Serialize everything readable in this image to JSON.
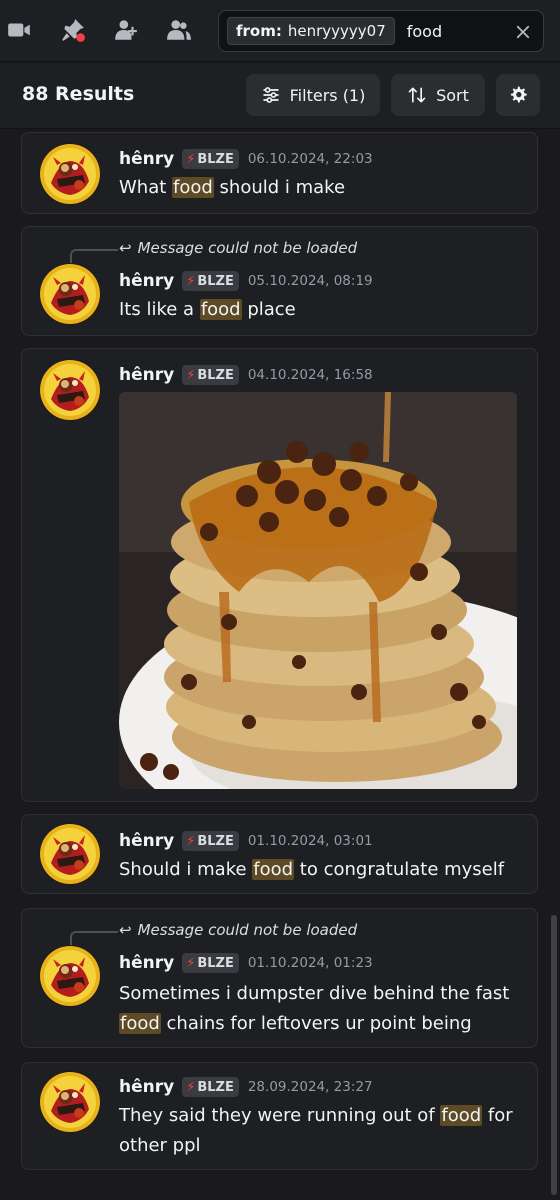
{
  "toolbar": {
    "icons": [
      "video-camera-icon",
      "pinned-messages-icon",
      "add-member-icon",
      "members-icon"
    ],
    "search": {
      "filter_key": "from:",
      "filter_value": "henryyyyy07",
      "query": "food"
    }
  },
  "results_header": {
    "count_label": "88 Results",
    "filters_label": "Filters (1)",
    "sort_label": "Sort"
  },
  "messages": [
    {
      "username": "hênry",
      "tag": "BLZE",
      "timestamp": "06.10.2024, 22:03",
      "text_before": "What ",
      "highlight": "food",
      "text_after": " should i make"
    },
    {
      "reply_note": "Message could not be loaded",
      "username": "hênry",
      "tag": "BLZE",
      "timestamp": "05.10.2024, 08:19",
      "text_before": "Its like a ",
      "highlight": "food",
      "text_after": " place"
    },
    {
      "username": "hênry",
      "tag": "BLZE",
      "timestamp": "04.10.2024, 16:58",
      "attachment": "image"
    },
    {
      "username": "hênry",
      "tag": "BLZE",
      "timestamp": "01.10.2024, 03:01",
      "text_before": "Should i make ",
      "highlight": "food",
      "text_after": " to congratulate myself"
    },
    {
      "reply_note": "Message could not be loaded",
      "username": "hênry",
      "tag": "BLZE",
      "timestamp": "01.10.2024, 01:23",
      "line1": "Sometimes i dumpster dive behind the fast",
      "highlight": "food",
      "line2_after": " chains for leftovers ur point being"
    },
    {
      "username": "hênry",
      "tag": "BLZE",
      "timestamp": "28.09.2024, 23:27",
      "line1_before": "They said they were running out of ",
      "highlight": "food",
      "line1_after": " for",
      "line2": "other ppl"
    }
  ],
  "colors": {
    "background": "#1a1a1e",
    "card": "#1e1f22",
    "highlight": "#5e4a24",
    "tag_bolt": "#f23f43",
    "muted": "#949ba4"
  }
}
